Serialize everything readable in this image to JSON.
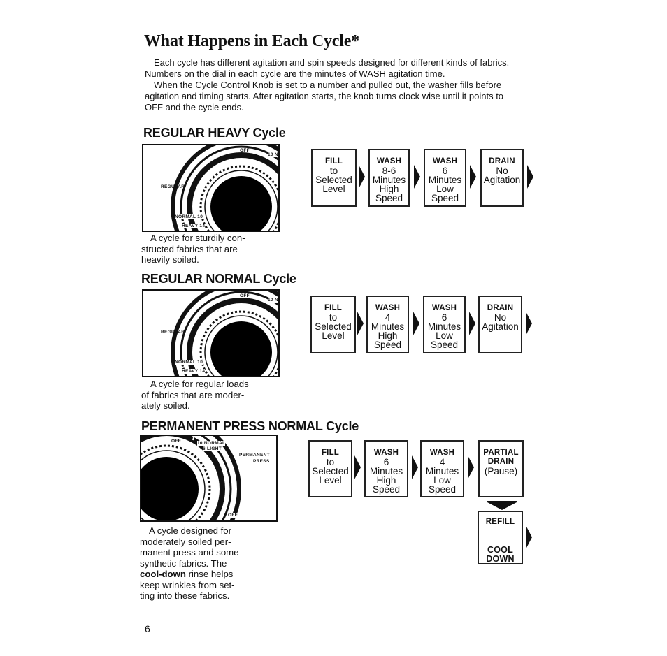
{
  "page": {
    "title": "What Happens in Each Cycle*",
    "intro_paragraphs": [
      "Each cycle has different agitation and spin speeds designed for different kinds of fabrics. Numbers on the dial in each cycle are the minutes of WASH agitation time.",
      "When the Cycle Control Knob is set to a number and pulled out, the washer fills before agitation and timing starts. After agitation starts, the knob turns clock wise until it points to OFF and the cycle ends."
    ],
    "page_number": "6"
  },
  "sections": [
    {
      "heading": "REGULAR HEAVY Cycle",
      "dial": {
        "off_label": "OFF",
        "top_right_label": "10 N",
        "side_label": "REGULAR",
        "normal_label": "NORMAL 10",
        "heavy_label": "HEAVY 14"
      },
      "description": [
        "A cycle for sturdily con-",
        "structed fabrics that are",
        "heavily soiled."
      ],
      "steps": [
        {
          "head": "FILL",
          "lines": [
            "to",
            "Selected",
            "Level"
          ]
        },
        {
          "head": "WASH",
          "lines": [
            "8-6",
            "Minutes",
            "High",
            "Speed"
          ]
        },
        {
          "head": "WASH",
          "lines": [
            "6",
            "Minutes",
            "Low",
            "Speed"
          ]
        },
        {
          "head": "DRAIN",
          "lines": [
            "No",
            "Agitation"
          ]
        }
      ]
    },
    {
      "heading": "REGULAR NORMAL Cycle",
      "dial": {
        "off_label": "OFF",
        "top_right_label": "10 N",
        "side_label": "REGULAR",
        "normal_label": "NORMAL 10",
        "heavy_label": "HEAVY 14"
      },
      "description": [
        "A cycle for regular loads",
        "of fabrics that are moder-",
        "ately soiled."
      ],
      "steps": [
        {
          "head": "FILL",
          "lines": [
            "to",
            "Selected",
            "Level"
          ]
        },
        {
          "head": "WASH",
          "lines": [
            "4",
            "Minutes",
            "High",
            "Speed"
          ]
        },
        {
          "head": "WASH",
          "lines": [
            "6",
            "Minutes",
            "Low",
            "Speed"
          ]
        },
        {
          "head": "DRAIN",
          "lines": [
            "No",
            "Agitation"
          ]
        }
      ]
    },
    {
      "heading": "PERMANENT PRESS NORMAL Cycle",
      "dial": {
        "off_label": "OFF",
        "normal_label": "10 NORMAL",
        "light_label": "6 LIGHT",
        "side_label_1": "PERMANENT",
        "side_label_2": "PRESS",
        "bottom_off_label": "OFF"
      },
      "description_lines": [
        {
          "text": "A cycle designed for",
          "bold_prefix": ""
        },
        {
          "text": "moderately soiled per-",
          "bold_prefix": ""
        },
        {
          "text": "manent press and some",
          "bold_prefix": ""
        },
        {
          "text": "synthetic fabrics. The",
          "bold_prefix": ""
        },
        {
          "text": " rinse helps",
          "bold_prefix": "cool-down"
        },
        {
          "text": "keep wrinkles from set-",
          "bold_prefix": ""
        },
        {
          "text": "ting into these fabrics.",
          "bold_prefix": ""
        }
      ],
      "steps": [
        {
          "head": "FILL",
          "lines": [
            "to",
            "Selected",
            "Level"
          ]
        },
        {
          "head": "WASH",
          "lines": [
            "6",
            "Minutes",
            "High",
            "Speed"
          ]
        },
        {
          "head": "WASH",
          "lines": [
            "4",
            "Minutes",
            "Low",
            "Speed"
          ]
        },
        {
          "head": "PARTIAL",
          "head2": "DRAIN",
          "lines": [
            "(Pause)"
          ]
        }
      ],
      "final_step": {
        "head": "REFILL",
        "head2": "COOL",
        "head3": "DOWN"
      }
    }
  ]
}
